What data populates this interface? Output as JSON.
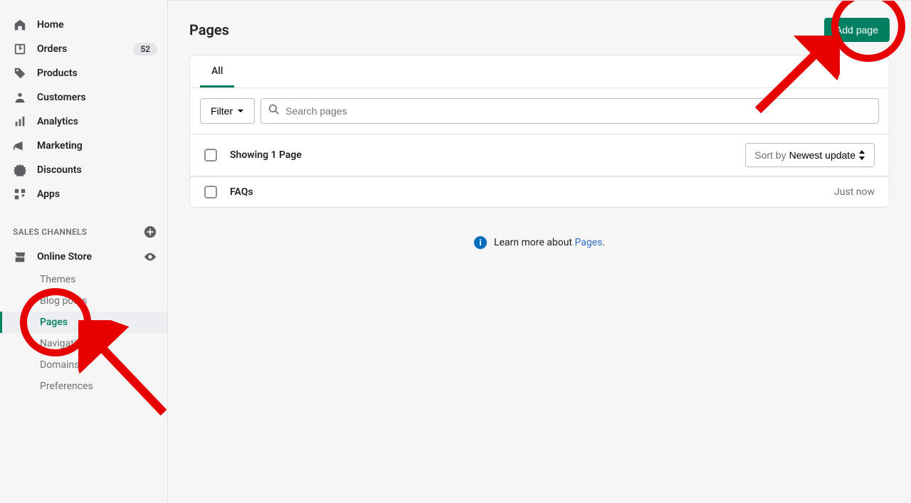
{
  "sidebar": {
    "items": [
      {
        "label": "Home"
      },
      {
        "label": "Orders",
        "badge": "52"
      },
      {
        "label": "Products"
      },
      {
        "label": "Customers"
      },
      {
        "label": "Analytics"
      },
      {
        "label": "Marketing"
      },
      {
        "label": "Discounts"
      },
      {
        "label": "Apps"
      }
    ],
    "section_label": "SALES CHANNELS",
    "channel": {
      "label": "Online Store"
    },
    "sub": [
      {
        "label": "Themes"
      },
      {
        "label": "Blog posts"
      },
      {
        "label": "Pages"
      },
      {
        "label": "Navigation"
      },
      {
        "label": "Domains"
      },
      {
        "label": "Preferences"
      }
    ]
  },
  "header": {
    "title": "Pages",
    "add_button": "Add page"
  },
  "tabs": {
    "all": "All"
  },
  "filters": {
    "filter_label": "Filter",
    "search_placeholder": "Search pages"
  },
  "list": {
    "showing": "Showing 1 Page",
    "sort_label": "Sort by",
    "sort_value": "Newest update",
    "rows": [
      {
        "title": "FAQs",
        "time": "Just now"
      }
    ]
  },
  "footer": {
    "text": "Learn more about ",
    "link": "Pages",
    "suffix": "."
  }
}
